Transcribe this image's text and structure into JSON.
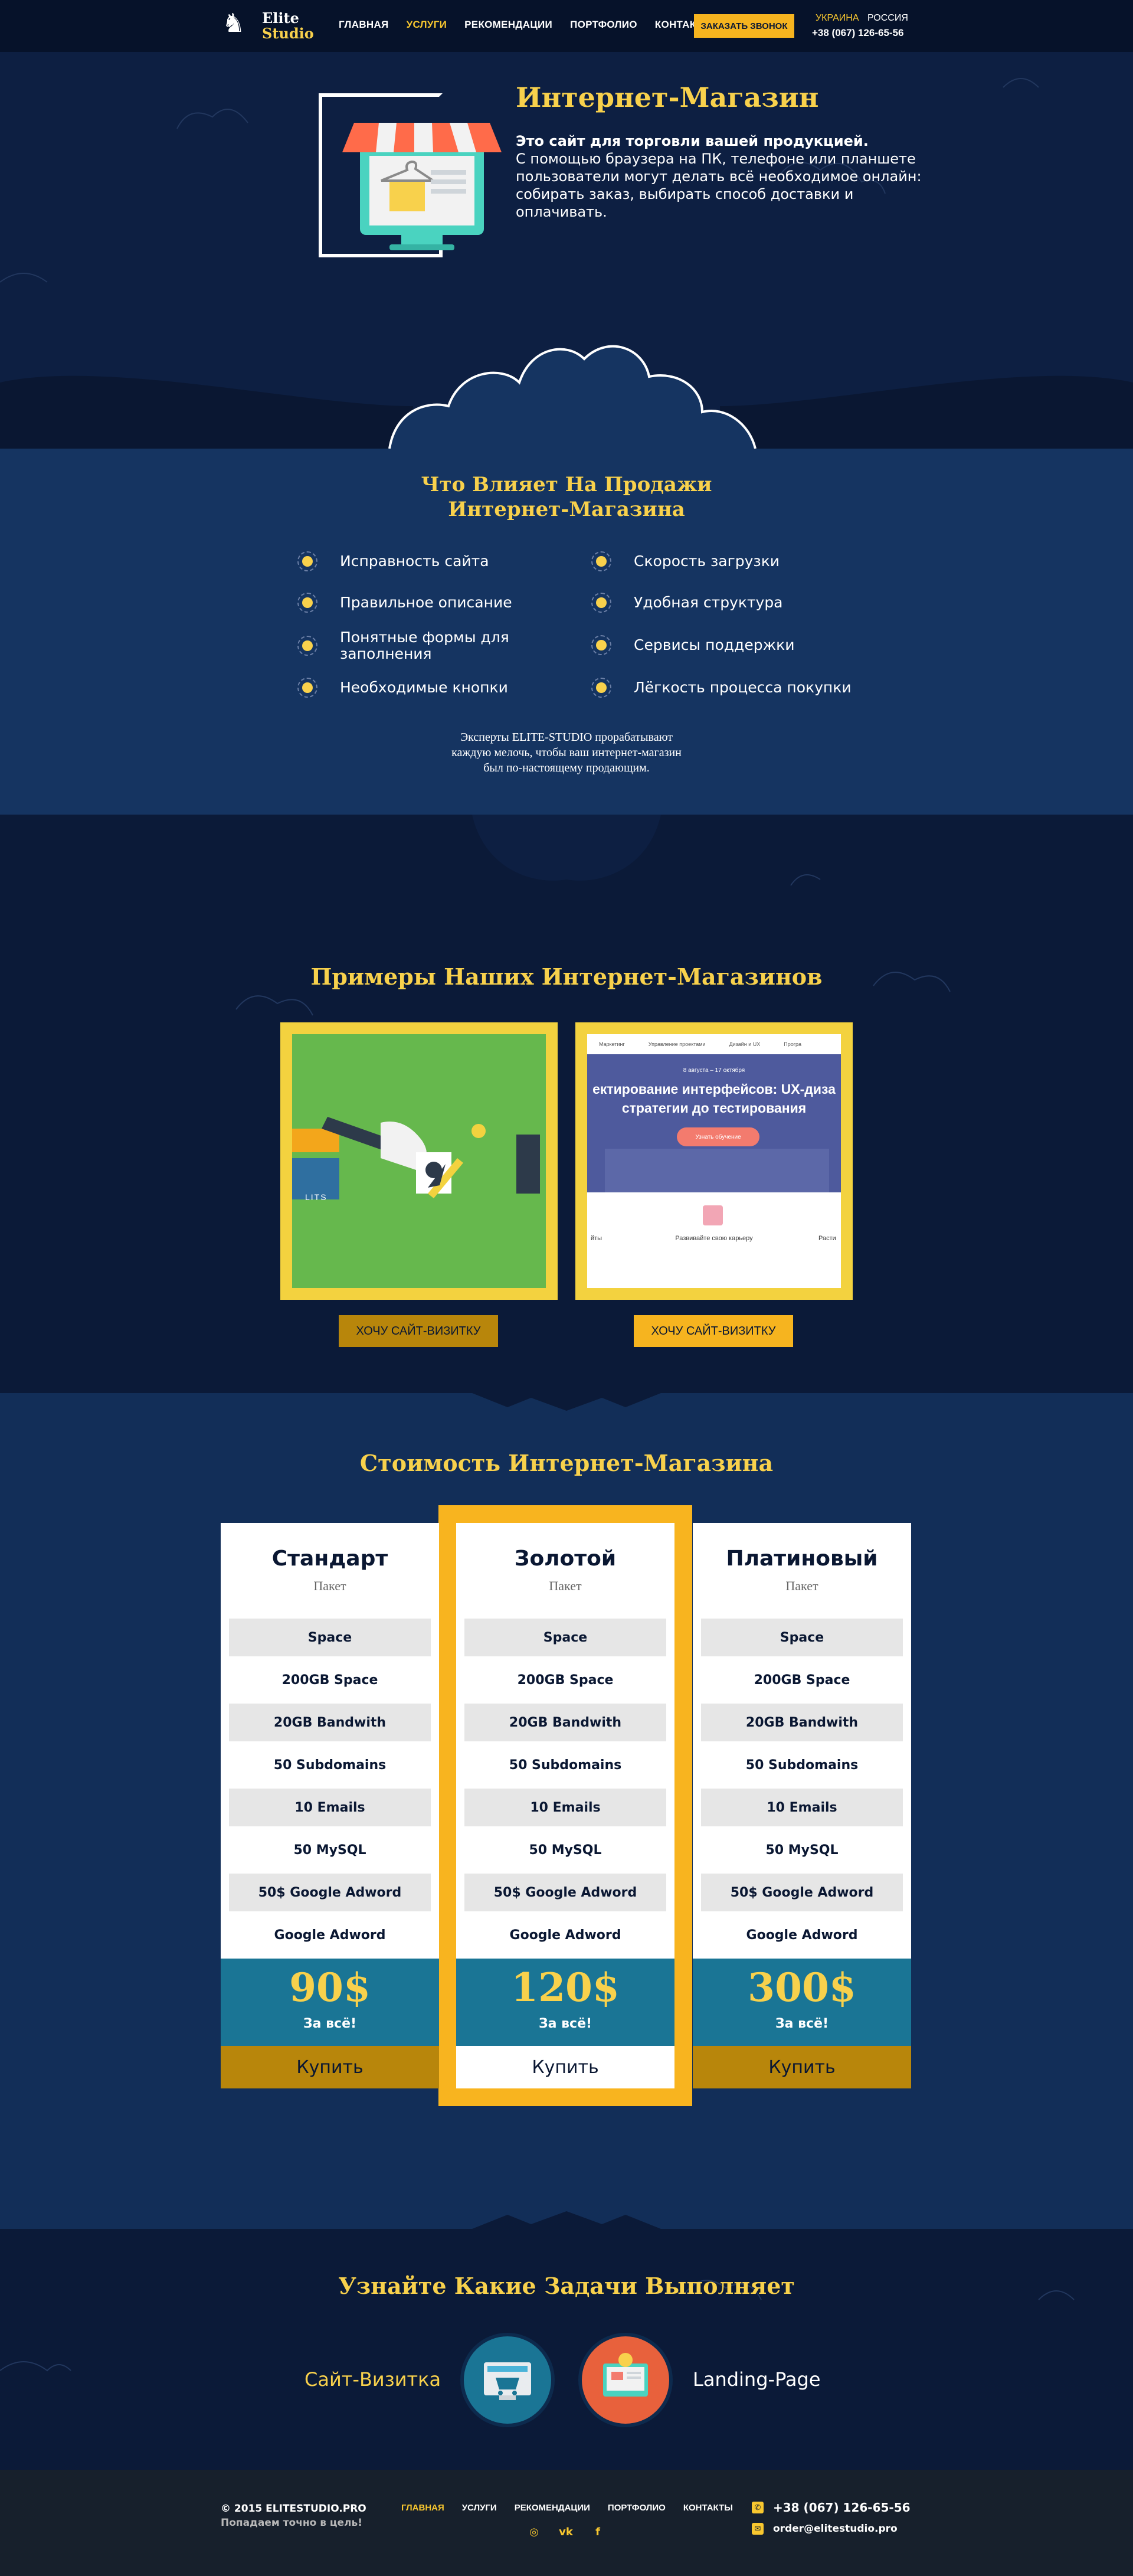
{
  "header": {
    "logo_line1": "Elite",
    "logo_line2": "Studio",
    "nav": [
      "ГЛАВНАЯ",
      "УСЛУГИ",
      "РЕКОМЕНДАЦИИ",
      "ПОРТФОЛИО",
      "КОНТАКТЫ"
    ],
    "active_nav": "УСЛУГИ",
    "call_button": "ЗАКАЗАТЬ ЗВОНОК",
    "region_ua": "УКРАИНА",
    "region_ru": "РОССИЯ",
    "phone": "+38 (067) 126-65-56"
  },
  "hero": {
    "title": "Интернет-Магазин",
    "lead": "Это сайт для торговли вашей продукцией.",
    "text": "С помощью браузера на ПК, телефоне или планшете пользователи могут делать всё необходимое онлайн: собирать заказ, выбирать способ доставки и оплачивать."
  },
  "factors": {
    "title_line1": "Что Влияет На Продажи",
    "title_line2": "Интернет-Магазина",
    "left": [
      "Исправность сайта",
      "Правильное описание",
      "Понятные формы для заполнения",
      "Необходимые кнопки"
    ],
    "right": [
      "Скорость загрузки",
      "Удобная структура",
      "Сервисы поддержки",
      "Лёгкость процесса покупки"
    ],
    "note_line1": "Эксперты ELITE-STUDIO прорабатывают",
    "note_line2": "каждую мелочь, чтобы ваш интернет-магазин",
    "note_line3": "был по-настоящему продающим."
  },
  "examples": {
    "title": "Примеры Наших Интернет-Магазинов",
    "button": "ХОЧУ САЙТ-ВИЗИТКУ",
    "card1_brand": "LITS",
    "card2_nav": [
      "Маркетинг",
      "Управление проектами",
      "Дизайн и UX",
      "Програ"
    ],
    "card2_date": "8 августа – 17 октября",
    "card2_heading1": "ектирование интерфейсов: UX-диза",
    "card2_heading2": "стратегии до тестирования",
    "card2_cta": "Узнать обучение",
    "card2_caption": "Развивайте свою карьеру",
    "card2_left": "йты",
    "card2_right": "Расти"
  },
  "pricing": {
    "title": "Стоимость Интернет-Магазина",
    "package_label": "Пакет",
    "features": [
      "Space",
      "200GB Space",
      "20GB Bandwith",
      "50 Subdomains",
      "10 Emails",
      "50 MySQL",
      "50$ Google Adword",
      "Google Adword"
    ],
    "for_all": "За всё!",
    "buy": "Купить",
    "plans": [
      {
        "name": "Стандарт",
        "price": "90$"
      },
      {
        "name": "Золотой",
        "price": "120$"
      },
      {
        "name": "Платиновый",
        "price": "300$"
      }
    ],
    "colors": {
      "gold": "#f8b41f",
      "price_band": "#1a7595",
      "buy_dark": "#b8860b"
    }
  },
  "tasks": {
    "title": "Узнайте Какие Задачи Выполняет",
    "left_label": "Сайт-Визитка",
    "right_label": "Landing-Page"
  },
  "footer": {
    "copyright": "© 2015 ELITESTUDIO.PRO",
    "slogan": "Попадаем точно в цель!",
    "nav": [
      "ГЛАВНАЯ",
      "УСЛУГИ",
      "РЕКОМЕНДАЦИИ",
      "ПОРТФОЛИО",
      "КОНТАКТЫ"
    ],
    "phone": "+38 (067) 126-65-56",
    "email": "order@elitestudio.pro",
    "socials": [
      "instagram-icon",
      "vk-icon",
      "facebook-icon"
    ]
  }
}
